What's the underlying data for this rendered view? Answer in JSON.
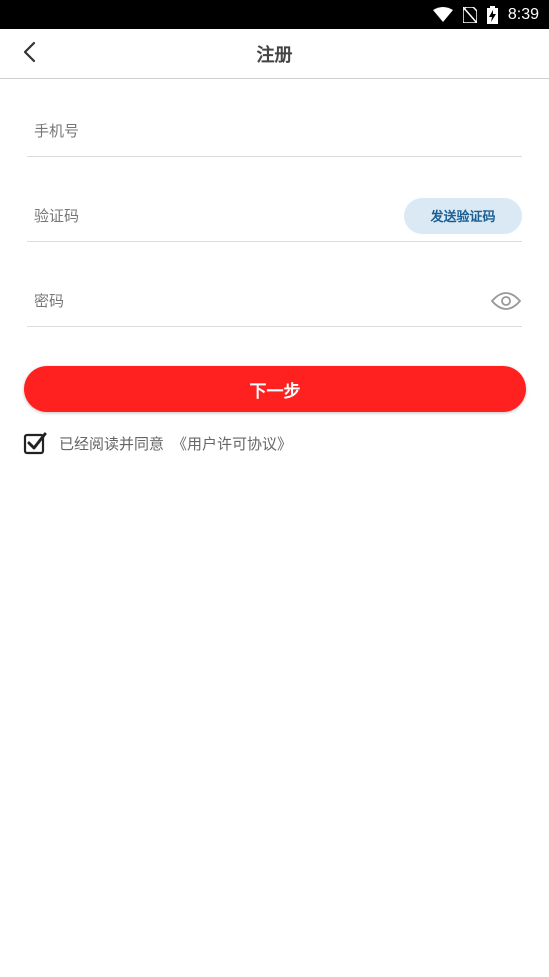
{
  "status_bar": {
    "time": "8:39",
    "icons": [
      "wifi-icon",
      "no-sim-icon",
      "battery-charging-icon"
    ]
  },
  "header": {
    "title": "注册",
    "back_icon": "chevron-left-icon"
  },
  "form": {
    "phone": {
      "value": "",
      "placeholder": "手机号"
    },
    "code": {
      "value": "",
      "placeholder": "验证码",
      "send_button_label": "发送验证码"
    },
    "password": {
      "value": "",
      "placeholder": "密码",
      "toggle_icon": "eye-icon"
    }
  },
  "next_button": {
    "label": "下一步"
  },
  "agreement": {
    "checked": true,
    "text": "已经阅读并同意",
    "link": "《用户许可协议》"
  },
  "colors": {
    "primary": "#ff2020",
    "send_button_bg": "#dbe9f4",
    "send_button_text": "#1a5f94"
  }
}
